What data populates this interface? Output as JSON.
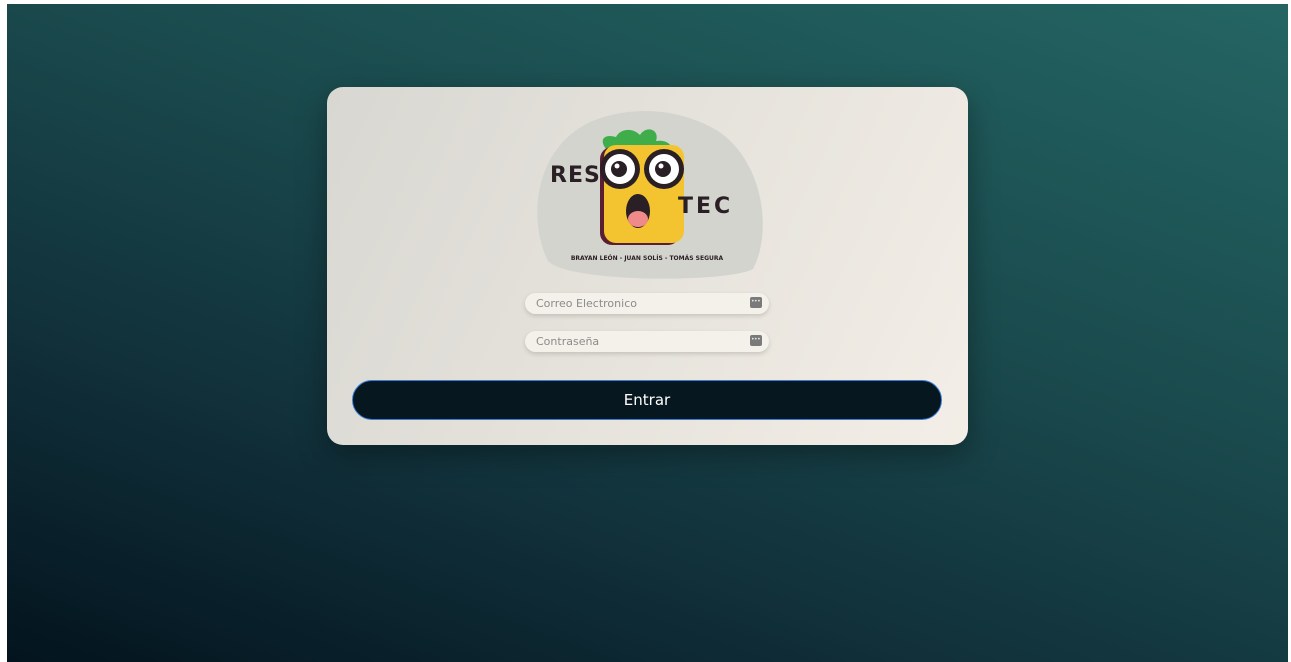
{
  "logo": {
    "word_left": "RES",
    "word_right": "TEC",
    "authors": "BRAYAN LEÓN - JUAN SOLÍS - TOMÁS SEGURA"
  },
  "form": {
    "email": {
      "placeholder": "Correo Electronico",
      "value": ""
    },
    "password": {
      "placeholder": "Contraseña",
      "value": ""
    },
    "submit_label": "Entrar"
  },
  "colors": {
    "background_start": "#03141e",
    "background_end": "#246563",
    "card": "#e6e3dc",
    "button": "#061720",
    "button_border": "#3b7dd8",
    "mascot_body": "#f4c430",
    "mascot_leaves": "#3fae4a"
  },
  "icons": {
    "field_icon": "password-manager-key-icon"
  }
}
